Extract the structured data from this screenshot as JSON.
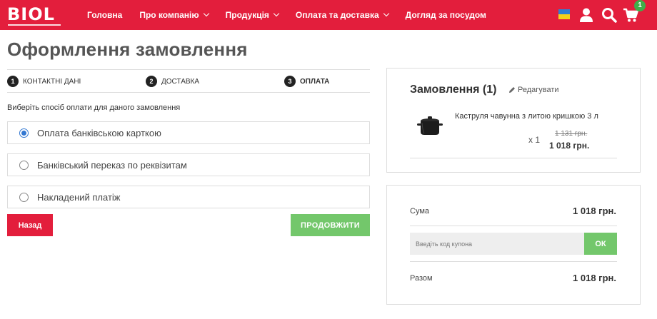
{
  "header": {
    "logo": "BIOL",
    "nav": [
      {
        "label": "Головна",
        "dropdown": false
      },
      {
        "label": "Про компанію",
        "dropdown": true
      },
      {
        "label": "Продукція",
        "dropdown": true
      },
      {
        "label": "Оплата та доставка",
        "dropdown": true
      },
      {
        "label": "Догляд за посудом",
        "dropdown": false
      }
    ],
    "cart_count": "1",
    "icons": [
      "ukraine-flag-icon",
      "user-icon",
      "search-icon",
      "cart-icon"
    ],
    "brand_color": "#e31e3c"
  },
  "page": {
    "title": "Оформлення замовлення"
  },
  "steps": [
    {
      "num": "1",
      "label": "КОНТАКТНІ ДАНІ",
      "active": false
    },
    {
      "num": "2",
      "label": "ДОСТАВКА",
      "active": false
    },
    {
      "num": "3",
      "label": "ОПЛАТА",
      "active": true
    }
  ],
  "payment": {
    "hint": "Виберіть спосіб оплати для даного замовлення",
    "options": [
      {
        "label": "Оплата банківською карткою",
        "selected": true
      },
      {
        "label": "Банківський переказ по реквізитам",
        "selected": false
      },
      {
        "label": "Накладений платіж",
        "selected": false
      }
    ],
    "back_label": "Назад",
    "next_label": "ПРОДОВЖИТИ"
  },
  "order": {
    "title": "Замовлення (1)",
    "edit_label": "Редагувати",
    "item": {
      "name": "Каструля чавунна з литою кришкою 3 л",
      "qty": "x 1",
      "old_price": "1 131 грн.",
      "price": "1 018 грн."
    }
  },
  "summary": {
    "sum_label": "Сума",
    "sum_value": "1 018 грн.",
    "coupon_placeholder": "Введіть код купона",
    "ok_label": "ОК",
    "total_label": "Разом",
    "total_value": "1 018 грн."
  }
}
